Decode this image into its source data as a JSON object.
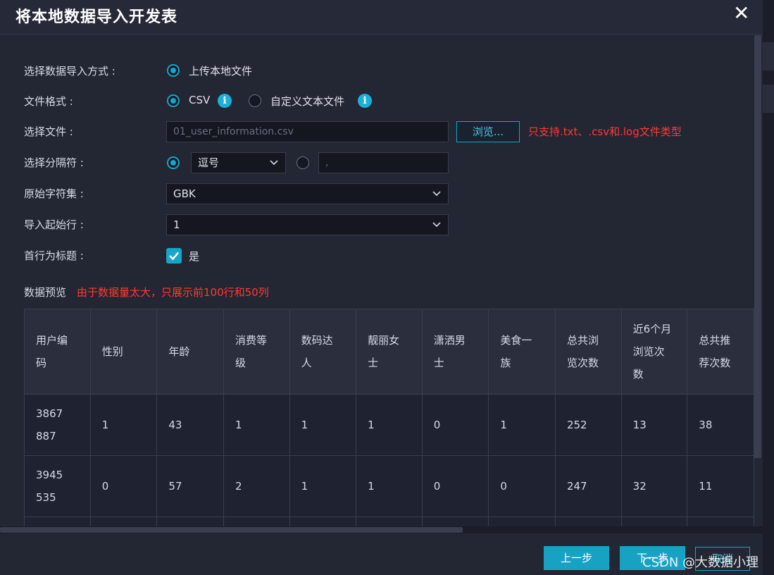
{
  "dialog": {
    "title": "将本地数据导入开发表",
    "close": "✕"
  },
  "form": {
    "method_label": "选择数据导入方式 :",
    "method_option": "上传本地文件",
    "format_label": "文件格式 :",
    "format_csv": "CSV",
    "format_custom": "自定义文本文件",
    "info_glyph": "i",
    "file_label": "选择文件 :",
    "file_value": "01_user_information.csv",
    "browse_label": "浏览...",
    "file_hint": "只支持.txt、.csv和.log文件类型",
    "delimiter_label": "选择分隔符 :",
    "delimiter_value": "逗号",
    "delimiter_custom_value": ",",
    "charset_label": "原始字符集 :",
    "charset_value": "GBK",
    "start_row_label": "导入起始行 :",
    "start_row_value": "1",
    "header_label": "首行为标题 :",
    "header_checked_label": "是"
  },
  "preview": {
    "label": "数据预览",
    "note": "由于数据量太大，只展示前100行和50列",
    "columns": [
      [
        "用户编",
        "码"
      ],
      [
        "性别"
      ],
      [
        "年龄"
      ],
      [
        "消费等",
        "级"
      ],
      [
        "数码达",
        "人"
      ],
      [
        "靓丽女",
        "士"
      ],
      [
        "潇洒男",
        "士"
      ],
      [
        "美食一",
        "族"
      ],
      [
        "总共浏",
        "览次数"
      ],
      [
        "近6个月",
        "浏览次",
        "数"
      ],
      [
        "总共推",
        "荐次数"
      ]
    ],
    "rows": [
      [
        [
          "3867",
          "887"
        ],
        "1",
        "43",
        "1",
        "1",
        "1",
        "0",
        "1",
        "252",
        "13",
        "38"
      ],
      [
        [
          "3945",
          "535"
        ],
        "0",
        "57",
        "2",
        "1",
        "1",
        "0",
        "0",
        "247",
        "32",
        "11"
      ]
    ]
  },
  "footer": {
    "prev_label": "上一步",
    "next_label": "下一步",
    "cancel_label": "取消",
    "watermark": "CSDN @大数据小理"
  },
  "colors": {
    "accent": "#16a6c9",
    "warning": "#ff3b30",
    "background": "#232633"
  }
}
